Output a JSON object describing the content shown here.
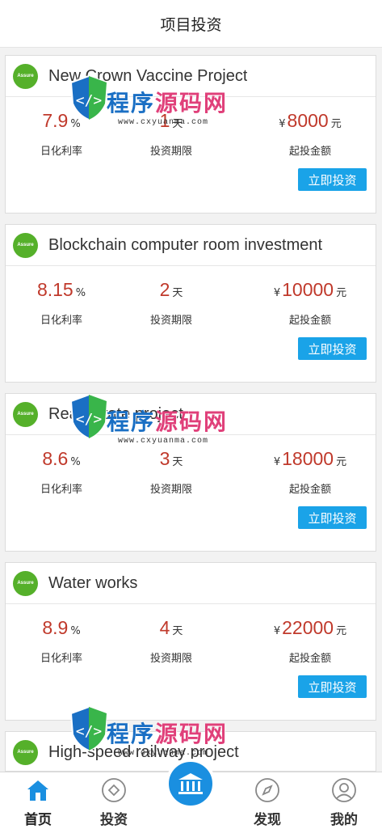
{
  "header": {
    "title": "项目投资"
  },
  "projects": [
    {
      "badge": "Assure",
      "name": "New Crown Vaccine Project",
      "rate": "7.9",
      "rate_unit": "%",
      "term": "1",
      "term_unit": "天",
      "currency": "¥",
      "amount": "8000",
      "amount_unit": "元",
      "rate_label": "日化利率",
      "term_label": "投资期限",
      "amount_label": "起投金额",
      "button": "立即投资"
    },
    {
      "badge": "Assure",
      "name": "Blockchain computer room investment",
      "rate": "8.15",
      "rate_unit": "%",
      "term": "2",
      "term_unit": "天",
      "currency": "¥",
      "amount": "10000",
      "amount_unit": "元",
      "rate_label": "日化利率",
      "term_label": "投资期限",
      "amount_label": "起投金额",
      "button": "立即投资"
    },
    {
      "badge": "Assure",
      "name": "Real estate project",
      "rate": "8.6",
      "rate_unit": "%",
      "term": "3",
      "term_unit": "天",
      "currency": "¥",
      "amount": "18000",
      "amount_unit": "元",
      "rate_label": "日化利率",
      "term_label": "投资期限",
      "amount_label": "起投金额",
      "button": "立即投资"
    },
    {
      "badge": "Assure",
      "name": "Water works",
      "rate": "8.9",
      "rate_unit": "%",
      "term": "4",
      "term_unit": "天",
      "currency": "¥",
      "amount": "22000",
      "amount_unit": "元",
      "rate_label": "日化利率",
      "term_label": "投资期限",
      "amount_label": "起投金额",
      "button": "立即投资"
    },
    {
      "badge": "Assure",
      "name": "High-speed railway project"
    }
  ],
  "watermark": {
    "text_a": "程序",
    "text_b": "源码网",
    "url": "www.cxyuanma.com"
  },
  "tabbar": {
    "items": [
      {
        "label": "首页",
        "icon": "home-icon",
        "color": "#1a8fe0"
      },
      {
        "label": "投资",
        "icon": "diamond-circle-icon"
      },
      {
        "label": "",
        "icon": "bank-icon"
      },
      {
        "label": "发现",
        "icon": "compass-icon"
      },
      {
        "label": "我的",
        "icon": "user-icon"
      }
    ]
  }
}
